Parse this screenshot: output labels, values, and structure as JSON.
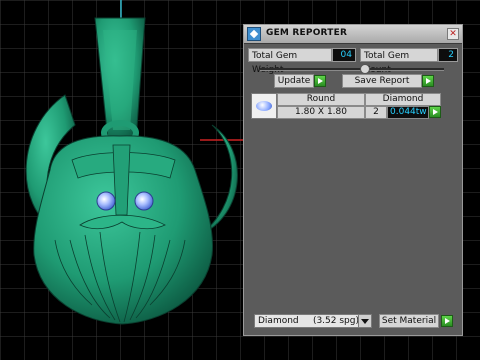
{
  "panel": {
    "title": "GEM REPORTER",
    "total_weight_label": "Total Gem Weight",
    "total_weight_value": "04",
    "total_count_label": "Total Gem Count",
    "total_count_value": "2",
    "slider_fraction": 0.57,
    "update_label": "Update",
    "save_report_label": "Save Report",
    "table": {
      "headers": [
        "Round",
        "Diamond"
      ],
      "row": {
        "size": "1.80 X 1.80",
        "qty": "2",
        "weight": "0.044tw"
      }
    },
    "material_value": "Diamond     (3.52 spg)",
    "set_material_label": "Set Material",
    "close_glyph": "✕"
  },
  "colors": {
    "model": "#1f9b73",
    "grid": "#3a3a3a",
    "axis_red": "#cc2222",
    "value_text": "#27d0ff",
    "gem": "#8aa8ff"
  },
  "icons": [
    "gem-reporter-icon",
    "close-icon",
    "go-arrow-icon",
    "dropdown-arrow-icon",
    "gem-thumbnail-icon"
  ]
}
